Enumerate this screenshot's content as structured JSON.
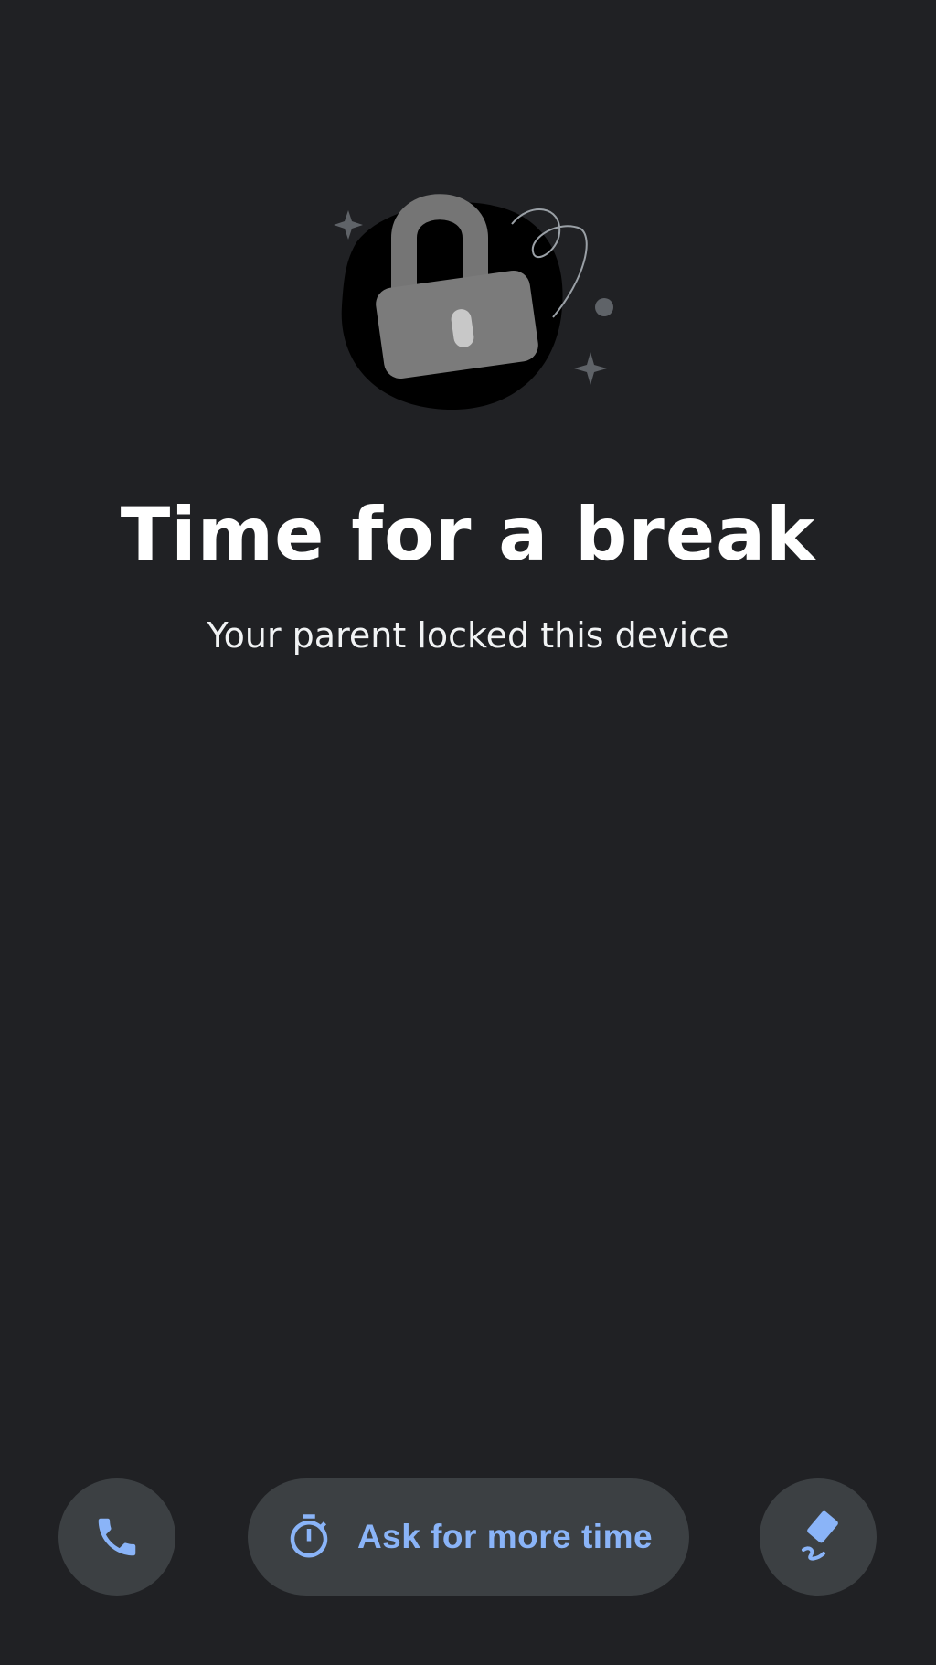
{
  "lock_screen": {
    "title": "Time for a break",
    "subtitle": "Your parent locked this device"
  },
  "actions": {
    "call_icon": "phone-icon",
    "ask_more_time_label": "Ask for more time",
    "timer_icon": "stopwatch-icon",
    "draw_icon": "marker-draw-icon"
  },
  "colors": {
    "background": "#202124",
    "button_background": "#3c4043",
    "accent": "#8ab4f8"
  }
}
